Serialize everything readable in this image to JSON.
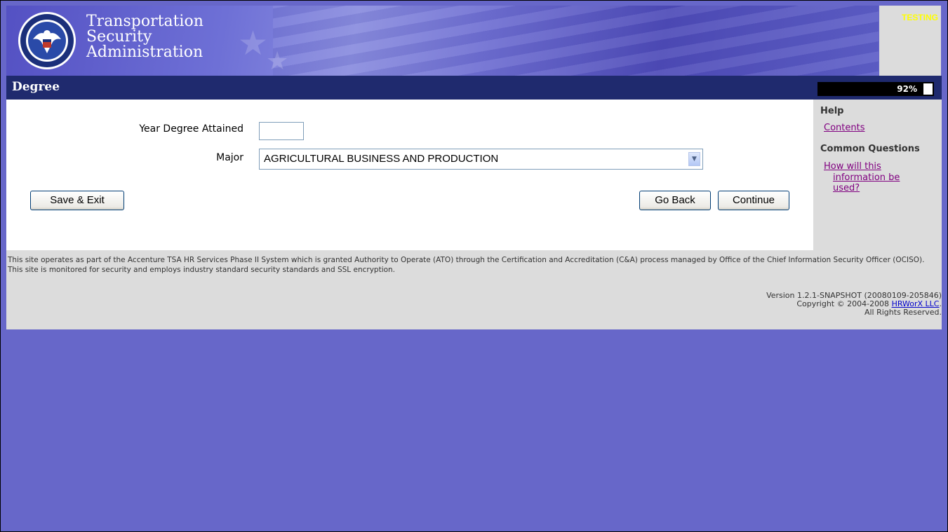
{
  "header": {
    "agency_line1": "Transportation",
    "agency_line2": "Security",
    "agency_line3": "Administration",
    "env_label": "TESTING"
  },
  "title_bar": {
    "title": "Degree",
    "progress_text": "92%",
    "progress_value": 0.92
  },
  "form": {
    "year_label": "Year Degree Attained",
    "year_value": "",
    "major_label": "Major",
    "major_value": "AGRICULTURAL BUSINESS AND PRODUCTION"
  },
  "buttons": {
    "save_exit": "Save & Exit",
    "go_back": "Go Back",
    "continue": "Continue"
  },
  "help": {
    "title": "Help",
    "contents_link": "Contents",
    "common_questions_title": "Common Questions",
    "question_line1": "How will this",
    "question_line2": "information be",
    "question_line3": "used?"
  },
  "footer": {
    "disclaimer": "This site operates as part of the Accenture TSA HR Services Phase II System which is granted Authority to Operate (ATO) through the Certification and Accreditation (C&A) process managed by Office of the Chief Information Security Officer (OCISO). This site is monitored for security and employs industry standard security standards and SSL encryption.",
    "version": "Version 1.2.1-SNAPSHOT (20080109-205846)",
    "copyright_prefix": "Copyright © 2004-2008 ",
    "company_link": "HRWorX LLC",
    "copyright_suffix": ".",
    "rights": "All Rights Reserved."
  },
  "colors": {
    "page_background": "#6767c9",
    "title_bar": "#1f2a6e",
    "env_label": "#ffff00",
    "visited_link": "#800080"
  },
  "icons": {
    "seal": "dhs-seal-icon",
    "dropdown": "chevron-down-icon"
  }
}
